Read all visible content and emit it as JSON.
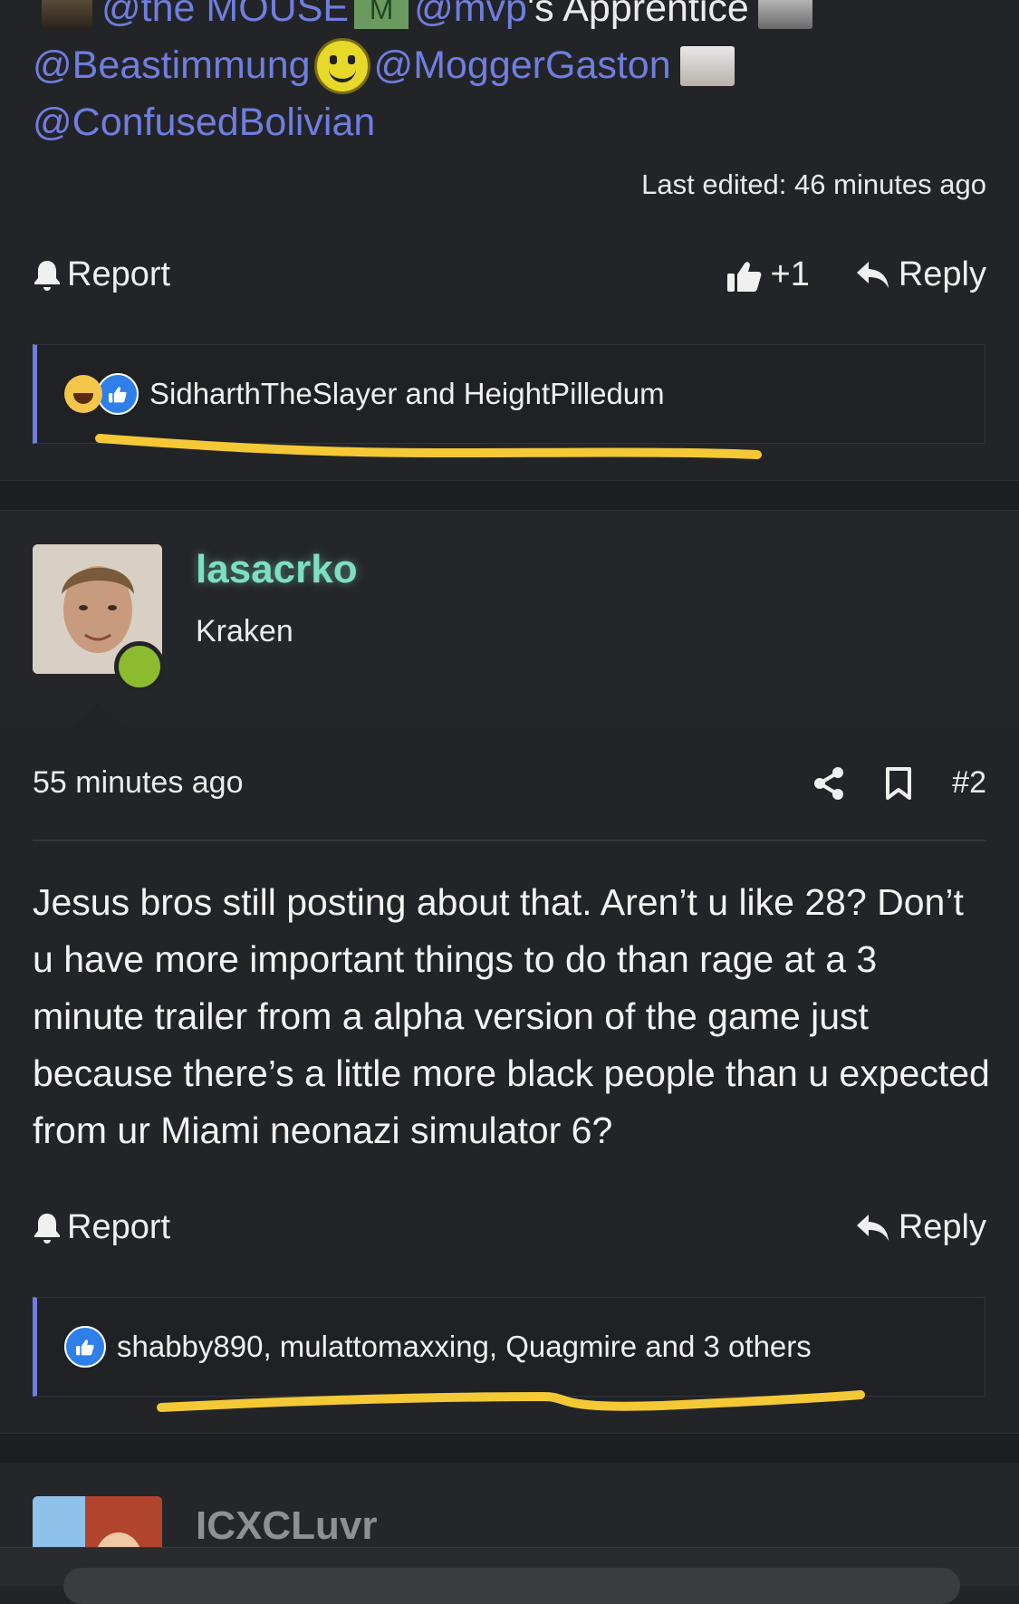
{
  "mentions": {
    "line1_a": "@the MOUSE",
    "line1_badge": "M",
    "line1_b": "@mvp",
    "line1_c": "'s Apprentice",
    "line2_a": "@Beastimmung",
    "line2_b": "@MoggerGaston",
    "line3": "@ConfusedBolivian"
  },
  "post1": {
    "last_edited": "Last edited: 46 minutes ago",
    "report_label": "Report",
    "like_label": "+1",
    "reply_label": "Reply",
    "reactions_text": "SidharthTheSlayer and HeightPilledum",
    "reaction_icons": [
      "laugh-emoji-icon",
      "like-emoji-icon"
    ]
  },
  "post2": {
    "username": "lasacrko",
    "user_title": "Kraken",
    "time": "55 minutes ago",
    "post_number": "#2",
    "body": "Jesus bros still posting about that. Aren’t u like 28? Don’t u have more important things to do than rage at a 3 minute trailer from a alpha version of the game just because there’s a little more black people than u expected from ur Miami neonazi simulator 6?",
    "report_label": "Report",
    "reply_label": "Reply",
    "reactions_text": "shabby890, mulattomaxxing, Quagmire and 3 others",
    "reaction_icons": [
      "like-emoji-icon"
    ]
  },
  "post3": {
    "username": "ICXCLuvr"
  },
  "colors": {
    "background": "#232427",
    "mention": "#6f7ee0",
    "username_accent": "#7ee0c0",
    "online": "#8dbb2f",
    "highlight_underline": "#f4c935"
  }
}
